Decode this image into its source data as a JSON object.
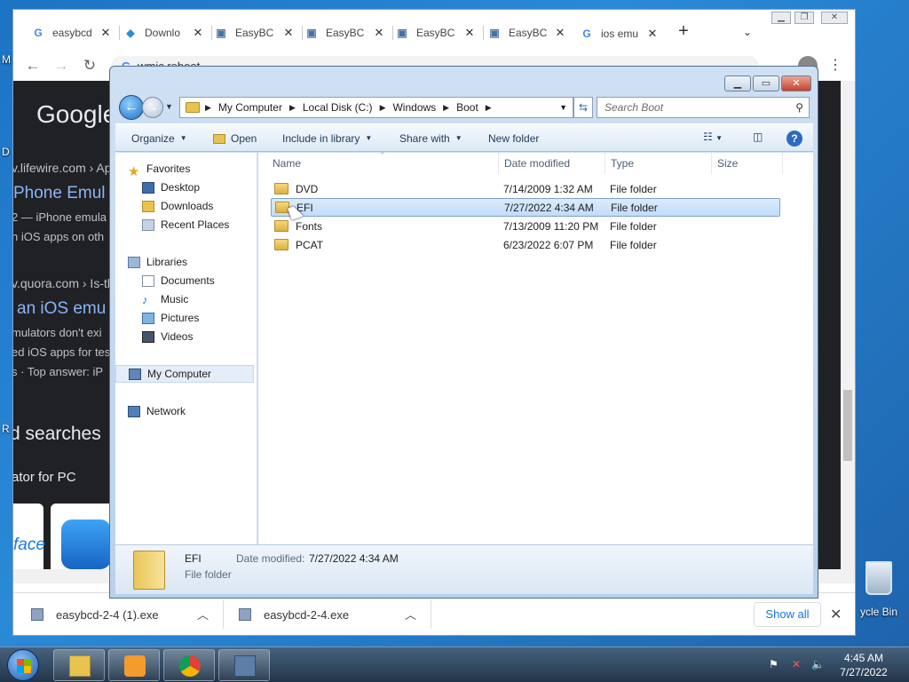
{
  "desktop": {
    "left_labels": [
      "M",
      "D",
      "R"
    ],
    "recycle_bin_label": "ycle Bin"
  },
  "chrome": {
    "tabs": [
      {
        "label": "easybcd",
        "icon": "google-icon"
      },
      {
        "label": "Downlo",
        "icon": "download-site-icon"
      },
      {
        "label": "EasyBC",
        "icon": "easybcd-icon"
      },
      {
        "label": "EasyBC",
        "icon": "easybcd-icon"
      },
      {
        "label": "EasyBC",
        "icon": "easybcd-icon"
      },
      {
        "label": "EasyBC",
        "icon": "easybcd-icon"
      },
      {
        "label": "ios emu",
        "icon": "google-icon"
      }
    ],
    "omnibox_text": "wmic reboot",
    "page_fragments": {
      "logo": "Google",
      "url1": "v.lifewire.com › Ap",
      "title1": "Phone Emul",
      "snippet1a": "2 — iPhone emula",
      "snippet1b": "n iOS apps on oth",
      "url2": "v.quora.com › Is-th",
      "title2": "an iOS emu",
      "snippet2a": "mulators don't exi",
      "snippet2b": "ed iOS apps for tes",
      "snippet2c": "s · Top answer: iP",
      "related": "d searches",
      "related_item": "ator for PC",
      "card_text": "face"
    },
    "downloads": [
      {
        "name": "easybcd-2-4 (1).exe"
      },
      {
        "name": "easybcd-2-4.exe"
      }
    ],
    "show_all": "Show all"
  },
  "explorer": {
    "breadcrumb": [
      "My Computer",
      "Local Disk (C:)",
      "Windows",
      "Boot"
    ],
    "search_placeholder": "Search Boot",
    "commands": {
      "organize": "Organize",
      "open": "Open",
      "include_in_library": "Include in library",
      "share_with": "Share with",
      "new_folder": "New folder"
    },
    "nav": {
      "favorites": "Favorites",
      "desktop": "Desktop",
      "downloads": "Downloads",
      "recent_places": "Recent Places",
      "libraries": "Libraries",
      "documents": "Documents",
      "music": "Music",
      "pictures": "Pictures",
      "videos": "Videos",
      "my_computer": "My Computer",
      "network": "Network"
    },
    "columns": {
      "name": "Name",
      "date": "Date modified",
      "type": "Type",
      "size": "Size"
    },
    "files": [
      {
        "name": "DVD",
        "date": "7/14/2009 1:32 AM",
        "type": "File folder"
      },
      {
        "name": "EFI",
        "date": "7/27/2022 4:34 AM",
        "type": "File folder",
        "selected": true
      },
      {
        "name": "Fonts",
        "date": "7/13/2009 11:20 PM",
        "type": "File folder"
      },
      {
        "name": "PCAT",
        "date": "6/23/2022 6:07 PM",
        "type": "File folder"
      }
    ],
    "details": {
      "name": "EFI",
      "date_label": "Date modified:",
      "date_value": "7/27/2022 4:34 AM",
      "type": "File folder"
    }
  },
  "taskbar": {
    "time": "4:45 AM",
    "date": "7/27/2022"
  }
}
